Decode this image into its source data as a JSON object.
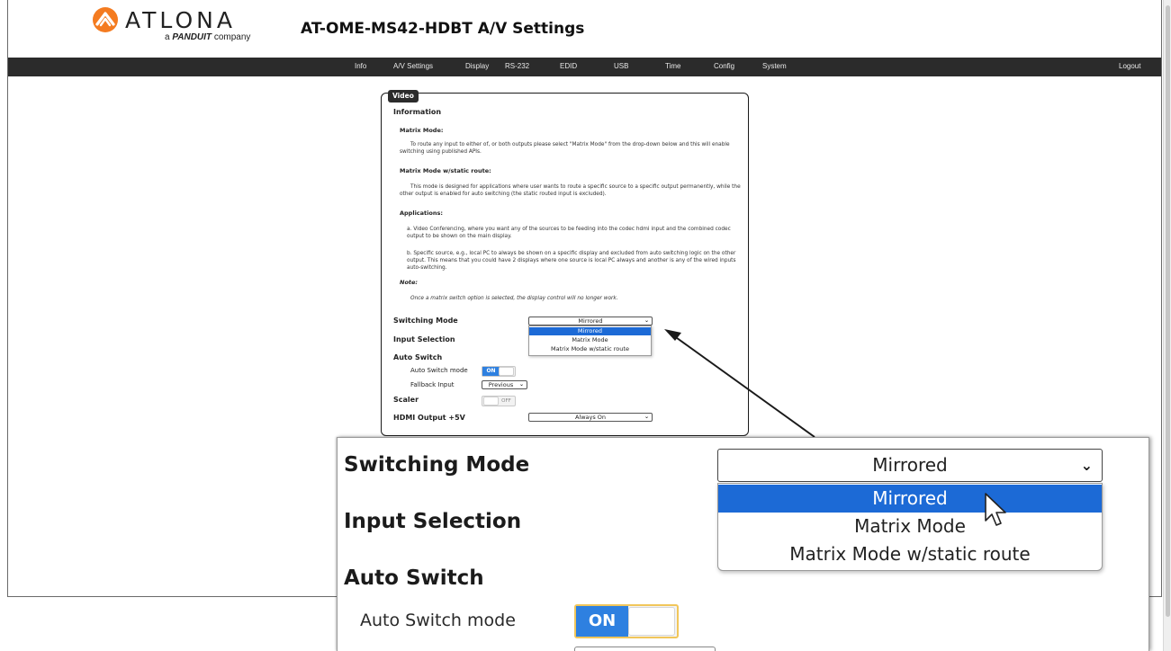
{
  "brand": {
    "logo_word": "ATLONA",
    "logo_sub_prefix": "a",
    "logo_sub_brand": "PANDUIT",
    "logo_sub_suffix": "company",
    "logo_color": "#f47b20"
  },
  "page_title": "AT-OME-MS42-HDBT  A/V Settings",
  "nav": {
    "items": [
      "Info",
      "A/V Settings",
      "Display",
      "RS-232",
      "EDID",
      "USB",
      "Time",
      "Config",
      "System"
    ],
    "logout": "Logout"
  },
  "video": {
    "tab_label": "Video",
    "info_heading": "Information",
    "matrix_mode_heading": "Matrix Mode:",
    "matrix_mode_text": "To route any input to either of, or both outputs please select \"Matrix Mode\" from the drop-down below and this will enable switching using published APIs.",
    "matrix_static_heading": "Matrix Mode w/static route:",
    "matrix_static_text": "This mode is designed for applications where user wants to route a specific source to a specific output permanently, while the other output is enabled for auto switching (the static routed input is excluded).",
    "applications_heading": "Applications:",
    "app_a": "a.  Video Conferencing, where you want any of the sources to be feeding into the codec hdmi input and the combined codec output to be shown on the main display.",
    "app_b": "b.  Specific source, e.g., local PC to always be shown on a specific display and excluded from auto switching logic on the other output. This means that you could have 2 displays where one source is local PC always and another is any of the wired inputs auto-switching.",
    "note_heading": "Note:",
    "note_text": "Once a matrix switch option is selected, the display control will no longer work.",
    "switching_mode_label": "Switching Mode",
    "switching_mode_value": "Mirrored",
    "switching_mode_options": [
      "Mirrored",
      "Matrix Mode",
      "Matrix Mode w/static route"
    ],
    "input_selection_label": "Input Selection",
    "auto_switch_label": "Auto Switch",
    "auto_switch_mode_label": "Auto Switch mode",
    "auto_switch_mode_state": "ON",
    "fallback_input_label": "Fallback Input",
    "fallback_input_value": "Previous",
    "scaler_label": "Scaler",
    "scaler_state": "OFF",
    "hdmi_output_label": "HDMI Output +5V",
    "hdmi_output_value": "Always On"
  },
  "colors": {
    "nav_bg": "#2b2b2b",
    "selected_option": "#1c6ad6",
    "toggle_on": "#2e80e0",
    "toggle_highlight": "#f1c65a"
  }
}
